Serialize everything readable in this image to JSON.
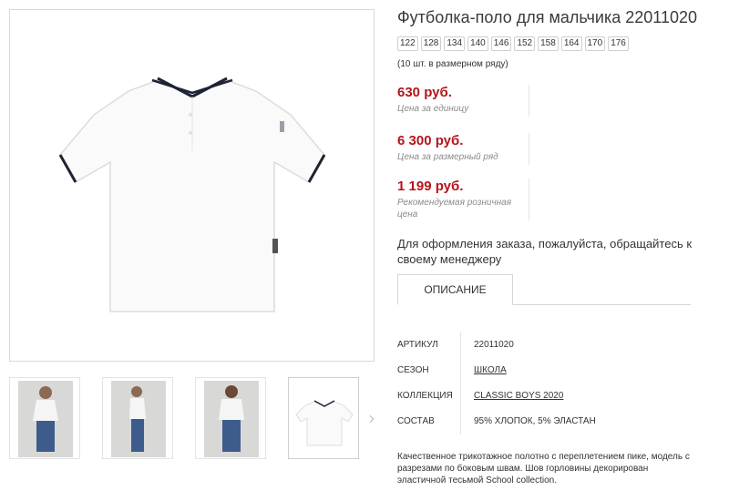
{
  "product": {
    "title": "Футболка-поло для мальчика 22011020",
    "sizes": [
      "122",
      "128",
      "134",
      "140",
      "146",
      "152",
      "158",
      "164",
      "170",
      "176"
    ],
    "sizes_note": "(10 шт. в размерном ряду)",
    "prices": [
      {
        "value": "630 руб.",
        "label": "Цена за единицу"
      },
      {
        "value": "6 300 руб.",
        "label": "Цена за размерный ряд"
      },
      {
        "value": "1 199 руб.",
        "label": "Рекомендуемая розничная цена"
      }
    ],
    "contact_text": "Для оформления заказа, пожалуйста, обращайтесь к своему менеджеру",
    "tab_label": "ОПИСАНИЕ",
    "specs": [
      {
        "key": "АРТИКУЛ",
        "value": "22011020"
      },
      {
        "key": "СЕЗОН",
        "value": "ШКОЛА"
      },
      {
        "key": "КОЛЛЕКЦИЯ",
        "value": "CLASSIC BOYS 2020"
      },
      {
        "key": "СОСТАВ",
        "value": "95% ХЛОПОК, 5% ЭЛАСТАН"
      }
    ],
    "description": "Качественное трикотажное полотно с переплетением пике, модель с разрезами по боковым швам. Шов горловины декорирован эластичной тесьмой School collection."
  },
  "gallery": {
    "thumbnails": [
      "boy-front-photo",
      "boy-side-photo",
      "boy-back-photo",
      "polo-flat-photo"
    ],
    "next_icon": "chevron-right-icon"
  },
  "colors": {
    "price_red": "#b5141c",
    "trim_navy": "#1e2233",
    "jeans_blue": "#3d5c8c"
  }
}
